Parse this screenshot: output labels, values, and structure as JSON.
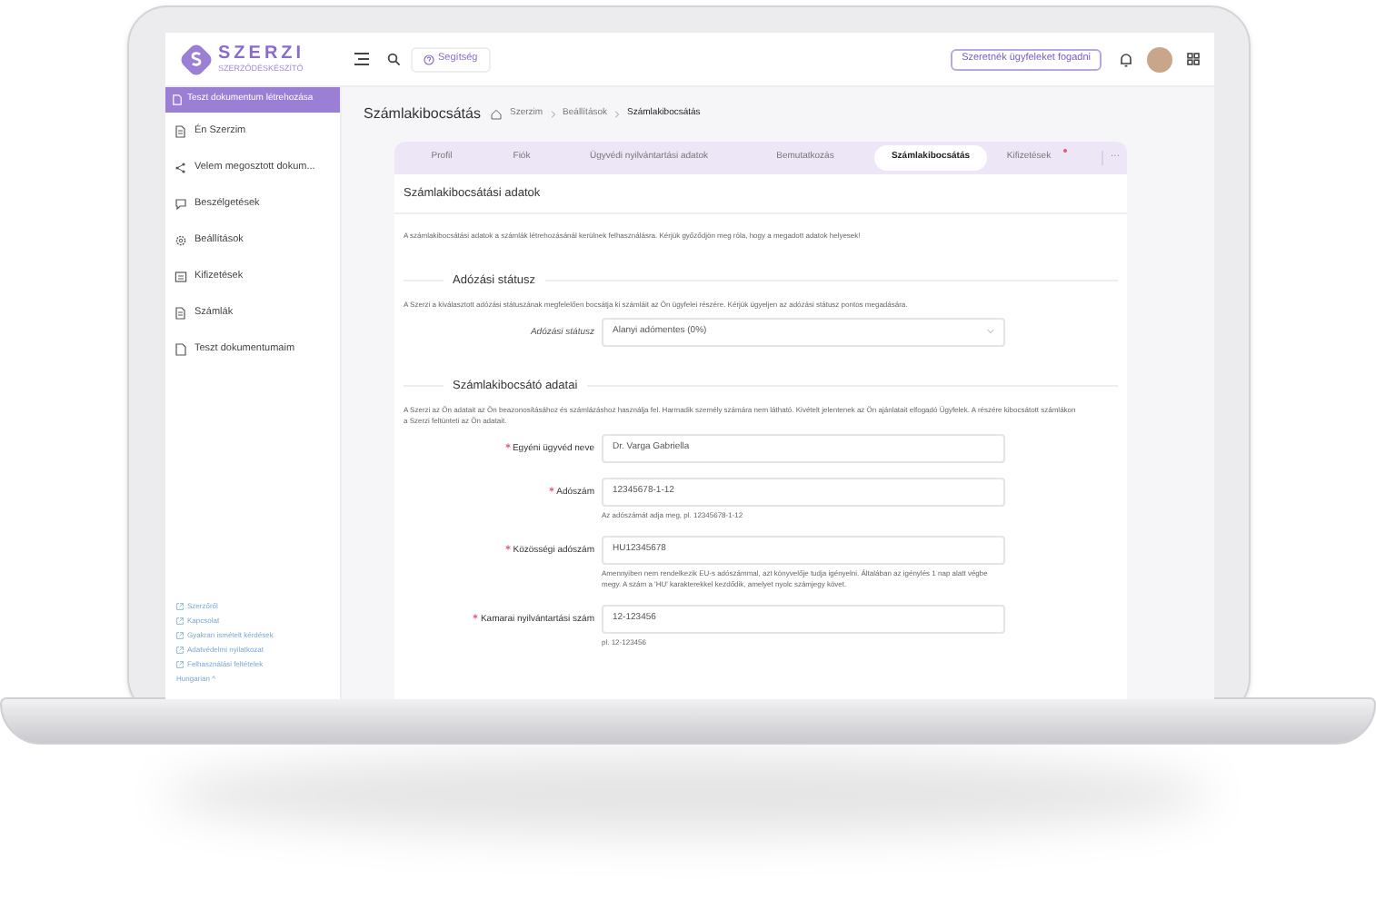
{
  "header": {
    "logo": "SZERZI",
    "logo_tagline": "SZERZŐDÉSKÉSZÍTŐ",
    "help_button": "Segítség",
    "cta_button": "Szeretnék ügyfeleket fogadni"
  },
  "sidebar": {
    "create_button": "Teszt dokumentum létrehozása",
    "items": [
      {
        "label": "Én Szerzim"
      },
      {
        "label": "Velem megosztott dokum..."
      },
      {
        "label": "Beszélgetések"
      },
      {
        "label": "Beállítások"
      },
      {
        "label": "Kifizetések"
      },
      {
        "label": "Számlák"
      },
      {
        "label": "Teszt dokumentumaim"
      }
    ],
    "footer_links": [
      "Szerzőről",
      "Kapcsolat",
      "Gyakran ismételt kérdések",
      "Adatvédelmi nyilatkozat",
      "Felhasználási feltételek"
    ],
    "language": "Hungarian ^"
  },
  "page_title": "Számlakibocsátás",
  "breadcrumb": [
    "Szerzim",
    "Beállítások",
    "Számlakibocsátás"
  ],
  "tabs": [
    {
      "label": "Profil",
      "selected": false,
      "badge": false
    },
    {
      "label": "Fiók",
      "selected": false,
      "badge": false
    },
    {
      "label": "Ügyvédi nyilvántartási adatok",
      "selected": false,
      "badge": false
    },
    {
      "label": "Bemutatkozás",
      "selected": false,
      "badge": false
    },
    {
      "label": "Számlakibocsátás",
      "selected": true,
      "badge": false
    },
    {
      "label": "Kifizetések",
      "selected": false,
      "badge": true
    }
  ],
  "tabs_more": "···",
  "card_title": "Számlakibocsátási adatok",
  "intro": "A számlakibocsátási adatok a számlák létrehozásánál kerülnek felhasználásra. Kérjük győződjön meg róla, hogy a megadott adatok helyesek!",
  "sections": [
    {
      "title": "Adózási státusz",
      "description": "A Szerzi a kiválasztott adózási státuszának megfelelően bocsátja ki számláit az Ön ügyfelei részére. Kérjük ügyeljen az adózási státusz pontos megadására.",
      "fields": [
        {
          "kind": "select",
          "label": "Adózási státusz",
          "required": false,
          "value": "Alanyi adómentes (0%)"
        }
      ]
    },
    {
      "title": "Számlakibocsátó adatai",
      "description": "A Szerzi az Ön adatait az Ön beazonosításához és számlázáshoz használja fel. Harmadik személy számára nem látható. Kivételt jelentenek az Ön ajánlatait elfogadó Ügyfelek. A részére kibocsátott számlákon a Szerzi feltünteti az Ön adatait.",
      "fields": [
        {
          "kind": "text",
          "label": "Egyéni ügyvéd neve",
          "required": true,
          "value": "Dr. Varga Gabriella"
        },
        {
          "kind": "text",
          "label": "Adószám",
          "required": true,
          "value": "12345678-1-12",
          "hint": "Az adószámát adja meg, pl. 12345678-1-12"
        },
        {
          "kind": "text",
          "label": "Közösségi adószám",
          "required": true,
          "value": "HU12345678",
          "hint": "Amennyiben nem rendelkezik EU-s adószámmal, azt könyvelője tudja igényelni. Általában az igénylés 1 nap alatt végbe megy. A szám a 'HU' karakterekkel kezdődik, amelyet nyolc számjegy követ."
        },
        {
          "kind": "text",
          "label": "Kamarai nyilvántartási szám",
          "required": true,
          "value": "12-123456",
          "hint": "pl. 12-123456"
        }
      ]
    }
  ]
}
